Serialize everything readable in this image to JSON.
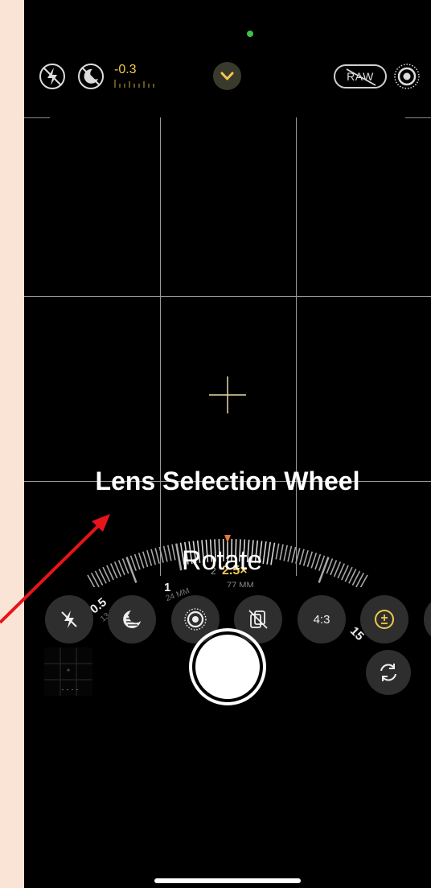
{
  "status": {
    "indicator_color": "#3fbf4a"
  },
  "top_bar": {
    "ev_value": "-0.3",
    "raw_label": "RAW",
    "icons": [
      "flash-off-icon",
      "night-mode-off-icon",
      "exposure-scale-icon",
      "chevron-down-icon",
      "raw-toggle-icon",
      "live-photo-icon"
    ]
  },
  "annotation": {
    "title": "Lens Selection Wheel",
    "hint": "Rotate",
    "arrow_color": "#e8141b"
  },
  "lens_wheel": {
    "current_zoom": "2.5×",
    "current_mm": "77 MM",
    "left_small": "2",
    "marks": [
      {
        "value": "0.5",
        "mm": "13 MM"
      },
      {
        "value": "1",
        "mm": "24 MM"
      },
      {
        "value": "15",
        "mm": ""
      }
    ],
    "indicator_color": "#e07a3a",
    "accent": "#f2c94c"
  },
  "controls": {
    "buttons": [
      {
        "name": "flash-button",
        "icon": "flash-off-icon",
        "label": ""
      },
      {
        "name": "night-mode-button",
        "icon": "night-mode-icon",
        "label": ""
      },
      {
        "name": "live-photo-button",
        "icon": "live-photo-icon",
        "label": ""
      },
      {
        "name": "styles-button",
        "icon": "photographic-styles-icon",
        "label": ""
      },
      {
        "name": "aspect-ratio-button",
        "icon": "",
        "label": "4:3"
      },
      {
        "name": "exposure-button",
        "icon": "exposure-icon",
        "label": ""
      }
    ]
  },
  "bottom": {
    "shutter_label": "",
    "flip_icon": "camera-flip-icon"
  }
}
